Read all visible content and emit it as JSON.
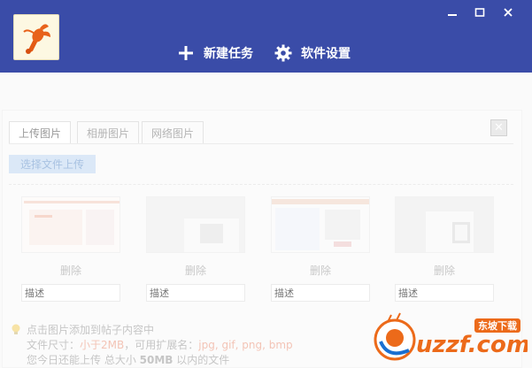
{
  "window": {
    "minimize_icon": "minimize-icon",
    "maximize_icon": "maximize-icon",
    "close_icon": "close-icon"
  },
  "toolbar": {
    "new_task_label": "新建任务",
    "settings_label": "软件设置"
  },
  "dialog": {
    "tabs": [
      {
        "label": "上传图片",
        "active": true
      },
      {
        "label": "相册图片",
        "active": false
      },
      {
        "label": "网络图片",
        "active": false
      }
    ],
    "upload_button": "选择文件上传",
    "close_glyph": "✕",
    "images": [
      {
        "delete_label": "删除",
        "desc_placeholder": "描述"
      },
      {
        "delete_label": "删除",
        "desc_placeholder": "描述"
      },
      {
        "delete_label": "删除",
        "desc_placeholder": "描述"
      },
      {
        "delete_label": "删除",
        "desc_placeholder": "描述"
      }
    ],
    "tips": {
      "line1": "点击图片添加到帖子内容中",
      "line2_prefix": "文件尺寸：",
      "line2_size": "小于2MB",
      "line2_mid": "，可用扩展名：",
      "line2_ext": "jpg, gif, png, bmp",
      "line3_prefix": "您今日还能上传 总大小 ",
      "line3_size": "50MB",
      "line3_suffix": " 以内的文件"
    }
  },
  "watermark": {
    "brand": "uzzf.com",
    "tag": "东坡下载"
  },
  "colors": {
    "header_bg": "#3a4ca8",
    "accent_watermark": "#ec6a1a"
  }
}
